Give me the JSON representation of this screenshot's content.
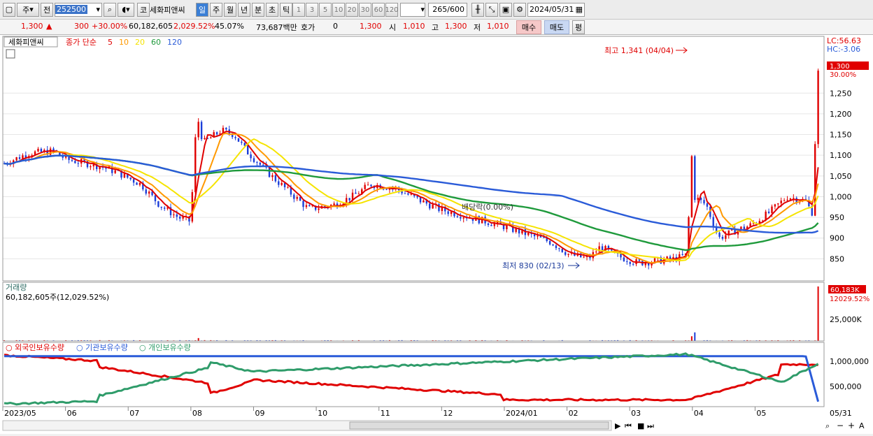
{
  "toolbar": {
    "period_label": "주",
    "all_label": "전",
    "code": "252500",
    "code_label": "코",
    "stock_name": "세화피앤씨",
    "periods": [
      "일",
      "주",
      "월",
      "년",
      "분",
      "초",
      "틱"
    ],
    "minutes": [
      "1",
      "3",
      "5",
      "10",
      "20",
      "30",
      "60",
      "120"
    ],
    "count": "265",
    "count_max": "/600",
    "date": "2024/05/31"
  },
  "quote": {
    "price": "1,300",
    "change": "300",
    "change_pct": "+30.00%",
    "volume": "60,182,605",
    "vol_ratio": "2,029.52%",
    "turnover": "45.07%",
    "amount": "73,687백만",
    "hoga_label": "호가",
    "hoga_value": "0",
    "hoga_price": "1,300",
    "open_label": "시",
    "open": "1,010",
    "high_label": "고",
    "high": "1,300",
    "low_label": "저",
    "low": "1,010",
    "buy_label": "매수",
    "sell_label": "매도",
    "eval_label": "평"
  },
  "main_panel": {
    "title": "세화피앤씨",
    "ma_prefix": "종가 단순",
    "ma_periods": [
      "5",
      "10",
      "20",
      "60",
      "120"
    ],
    "lc": "LC:56.63",
    "hc": "HC:-3.06",
    "max_note": "최고 1,341 (04/04)",
    "min_note": "최저 830 (02/13)",
    "dividend_note": "배당락(0.00%)",
    "price_tag": "1,300",
    "pct_tag": "30.00%"
  },
  "volume_panel": {
    "title": "거래량",
    "value_text": "60,182,605주(12,029.52%)",
    "tag": "60,183K",
    "tag_pct": "12029.52%",
    "tick": "25,000K"
  },
  "holding_panel": {
    "legend": [
      "외국인보유수량",
      "기관보유수량",
      "개인보유수량"
    ],
    "ticks": [
      "1,000,000",
      "500,000"
    ]
  },
  "x_axis": {
    "labels": [
      "2023/05",
      "06",
      "07",
      "08",
      "09",
      "10",
      "11",
      "12",
      "2024/01",
      "02",
      "03",
      "04",
      "05"
    ],
    "end_label": "05/31"
  },
  "chart_data": {
    "type": "line",
    "title": "세화피앤씨",
    "x_labels": [
      "2023/05",
      "06",
      "07",
      "08",
      "09",
      "10",
      "11",
      "12",
      "2024/01",
      "02",
      "03",
      "04",
      "05",
      "05/31"
    ],
    "price_axis": {
      "ticks": [
        850,
        900,
        950,
        1000,
        1050,
        1100,
        1150,
        1200,
        1250
      ],
      "range": [
        800,
        1350
      ]
    },
    "close_series": {
      "name": "종가",
      "points": [
        [
          0,
          1080
        ],
        [
          0.4,
          1105
        ],
        [
          0.8,
          1110
        ],
        [
          1.0,
          1090
        ],
        [
          1.5,
          1075
        ],
        [
          1.8,
          1060
        ],
        [
          2.2,
          1030
        ],
        [
          2.5,
          980
        ],
        [
          2.8,
          950
        ],
        [
          3.0,
          940
        ],
        [
          3.1,
          1200
        ],
        [
          3.2,
          1130
        ],
        [
          3.5,
          1160
        ],
        [
          3.7,
          1150
        ],
        [
          3.9,
          1110
        ],
        [
          4.3,
          1050
        ],
        [
          4.6,
          1010
        ],
        [
          4.9,
          970
        ],
        [
          5.3,
          980
        ],
        [
          5.6,
          1000
        ],
        [
          5.9,
          1030
        ],
        [
          6.3,
          1020
        ],
        [
          6.7,
          990
        ],
        [
          7.0,
          970
        ],
        [
          7.5,
          950
        ],
        [
          8.0,
          930
        ],
        [
          8.4,
          910
        ],
        [
          8.8,
          890
        ],
        [
          9.1,
          860
        ],
        [
          9.4,
          850
        ],
        [
          9.6,
          880
        ],
        [
          9.8,
          860
        ],
        [
          10.2,
          840
        ],
        [
          10.5,
          845
        ],
        [
          10.8,
          850
        ],
        [
          11.0,
          860
        ],
        [
          11.05,
          1140
        ],
        [
          11.1,
          1000
        ],
        [
          11.3,
          980
        ],
        [
          11.5,
          900
        ],
        [
          11.8,
          920
        ],
        [
          12.0,
          930
        ],
        [
          12.3,
          960
        ],
        [
          12.6,
          1000
        ],
        [
          12.9,
          990
        ],
        [
          13.0,
          960
        ],
        [
          13.1,
          1300
        ]
      ]
    },
    "ma_series": [
      {
        "name": "5",
        "color": "#e00000"
      },
      {
        "name": "10",
        "color": "#ff9900"
      },
      {
        "name": "20",
        "color": "#f5e400"
      },
      {
        "name": "60",
        "color": "#1f9a3c"
      },
      {
        "name": "120",
        "color": "#2a5bd8"
      }
    ],
    "volume": {
      "max_k": 60183,
      "unit": "K"
    },
    "holdings": {
      "series": [
        {
          "name": "외국인보유수량",
          "color": "#e00000"
        },
        {
          "name": "기관보유수량",
          "color": "#2a5bd8"
        },
        {
          "name": "개인보유수량",
          "color": "#2f9c6a"
        }
      ],
      "ticks": [
        1000000,
        500000
      ]
    }
  }
}
